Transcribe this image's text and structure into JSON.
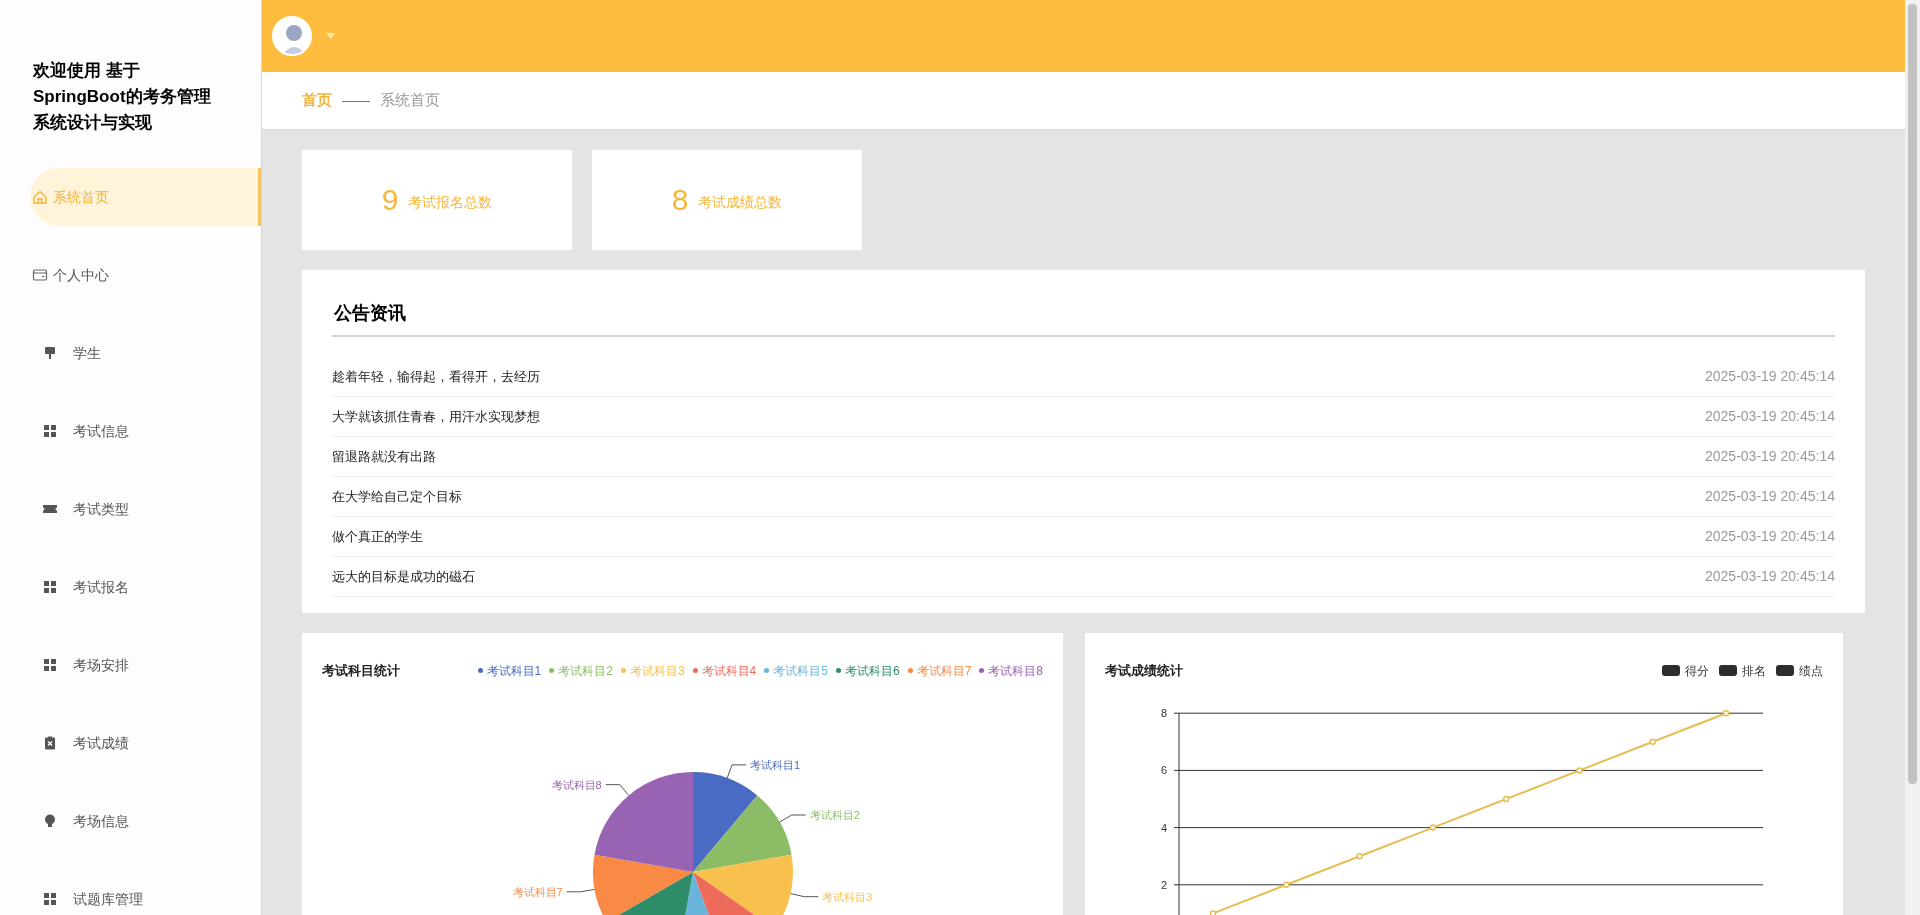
{
  "sidebar": {
    "title": "欢迎使用 基于SpringBoot的考务管理系统设计与实现",
    "items": [
      {
        "label": "系统首页",
        "selected": true
      },
      {
        "label": "个人中心",
        "selected": false
      },
      {
        "label": "学生",
        "selected": false
      },
      {
        "label": "考试信息",
        "selected": false
      },
      {
        "label": "考试类型",
        "selected": false
      },
      {
        "label": "考试报名",
        "selected": false
      },
      {
        "label": "考场安排",
        "selected": false
      },
      {
        "label": "考试成绩",
        "selected": false
      },
      {
        "label": "考场信息",
        "selected": false
      },
      {
        "label": "试题库管理",
        "selected": false
      }
    ]
  },
  "breadcrumb": {
    "home": "首页",
    "separator": "——",
    "current": "系统首页"
  },
  "stats": [
    {
      "value": "9",
      "label": "考试报名总数"
    },
    {
      "value": "8",
      "label": "考试成绩总数"
    }
  ],
  "notices": {
    "title": "公告资讯",
    "items": [
      {
        "title": "趁着年轻，输得起，看得开，去经历",
        "time": "2025-03-19 20:45:14"
      },
      {
        "title": "大学就该抓住青春，用汗水实现梦想",
        "time": "2025-03-19 20:45:14"
      },
      {
        "title": "留退路就没有出路",
        "time": "2025-03-19 20:45:14"
      },
      {
        "title": "在大学给自己定个目标",
        "time": "2025-03-19 20:45:14"
      },
      {
        "title": "做个真正的学生",
        "time": "2025-03-19 20:45:14"
      },
      {
        "title": "远大的目标是成功的磁石",
        "time": "2025-03-19 20:45:14"
      }
    ]
  },
  "subject_chart": {
    "title": "考试科目统计",
    "legend": [
      {
        "label": "考试科目1",
        "color": "#4a6bc4"
      },
      {
        "label": "考试科目2",
        "color": "#8cbd66"
      },
      {
        "label": "考试科目3",
        "color": "#f8c14e"
      },
      {
        "label": "考试科目4",
        "color": "#ee6a5a"
      },
      {
        "label": "考试科目5",
        "color": "#6ab4dc"
      },
      {
        "label": "考试科目6",
        "color": "#2e8c68"
      },
      {
        "label": "考试科目7",
        "color": "#f88a46"
      },
      {
        "label": "考试科目8",
        "color": "#9863b2"
      }
    ],
    "slice_labels": [
      "考试科目1",
      "考试科目2",
      "考试科目3",
      "考试科目7",
      "考试科目8"
    ]
  },
  "score_chart": {
    "title": "考试成绩统计",
    "legend": [
      "得分",
      "排名",
      "绩点"
    ],
    "chart_data": {
      "type": "line",
      "ylim": [
        0,
        8
      ],
      "yticks": [
        2,
        4,
        6,
        8
      ],
      "grid": true,
      "series": [
        {
          "color": "#e8bd55",
          "marker": true,
          "values": [
            1,
            2,
            3,
            4,
            5,
            6,
            7,
            8
          ]
        }
      ]
    }
  }
}
